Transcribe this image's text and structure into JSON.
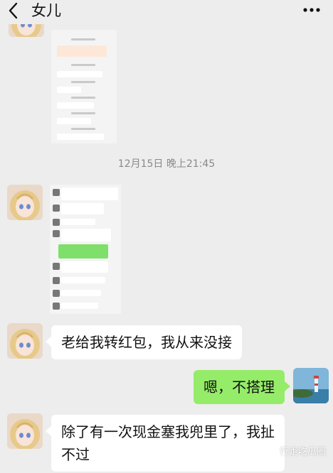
{
  "header": {
    "title": "女儿",
    "back_icon": "chevron-left-icon",
    "more_icon": "ellipsis-icon"
  },
  "timestamp": "12月15日 晚上21:45",
  "messages": [
    {
      "side": "left",
      "type": "image"
    },
    {
      "side": "left",
      "type": "image"
    },
    {
      "side": "left",
      "type": "text",
      "text": "老给我转红包，我从来没接"
    },
    {
      "side": "right",
      "type": "text",
      "text": "嗯，不搭理"
    },
    {
      "side": "left",
      "type": "text",
      "text": "除了有一次现金塞我兜里了，我扯\n不过"
    }
  ],
  "watermark": "行走吃瓜圈",
  "colors": {
    "background": "#ededed",
    "self_bubble": "#95ec69",
    "other_bubble": "#ffffff"
  }
}
